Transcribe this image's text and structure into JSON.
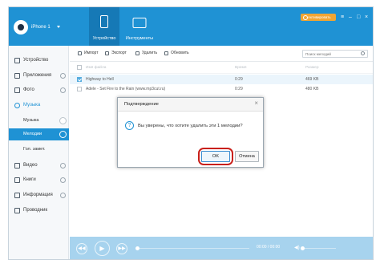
{
  "header": {
    "device_name": "iPhone 1",
    "tabs": [
      {
        "label": "Устройство",
        "icon": "phone-icon",
        "active": true
      },
      {
        "label": "Инструменты",
        "icon": "toolbox-icon",
        "active": false
      }
    ],
    "upgrade_label": "Активировать",
    "window_buttons": [
      "≡",
      "–",
      "□",
      "×"
    ]
  },
  "sidebar": {
    "items": [
      {
        "label": "Устройство",
        "icon": "device-icon"
      },
      {
        "label": "Приложения",
        "icon": "apps-icon"
      },
      {
        "label": "Фото",
        "icon": "photo-icon"
      },
      {
        "label": "Музыка",
        "icon": "music-icon"
      },
      {
        "label": "Видео",
        "icon": "video-icon"
      },
      {
        "label": "Книги",
        "icon": "books-icon"
      },
      {
        "label": "Информация",
        "icon": "info-icon"
      },
      {
        "label": "Проводник",
        "icon": "explorer-icon"
      }
    ],
    "music_sub": [
      {
        "label": "Музыка",
        "active": false
      },
      {
        "label": "Мелодии",
        "active": true
      },
      {
        "label": "Гол. замет.",
        "active": false
      }
    ]
  },
  "toolbar": {
    "import_label": "Импорт",
    "export_label": "Экспорт",
    "delete_label": "Удалить",
    "refresh_label": "Обновить",
    "search_placeholder": "Поиск мелодий"
  },
  "table": {
    "columns": [
      "Имя файла",
      "Время",
      "Размер"
    ],
    "rows": [
      {
        "name": "Highway to Hell",
        "time": "0:29",
        "size": "469 KB",
        "checked": true
      },
      {
        "name": "Adele - Set Fire to the Rain (www.mp3cut.ru)",
        "time": "0:29",
        "size": "480 KB",
        "checked": false
      }
    ]
  },
  "player": {
    "time": "00:00 / 00:00",
    "prev_glyph": "◀◀",
    "play_glyph": "▶",
    "next_glyph": "▶▶",
    "volume_glyph": "◀)"
  },
  "dialog": {
    "title": "Подтверждение",
    "close_glyph": "×",
    "question_glyph": "?",
    "message": "Вы уверены, что хотите удалить эти 1 мелодии?",
    "ok_label": "OK",
    "cancel_label": "Отмена"
  },
  "colors": {
    "brand": "#1f92d4",
    "upgrade": "#f1a532",
    "highlight_ring": "#c9201a"
  }
}
